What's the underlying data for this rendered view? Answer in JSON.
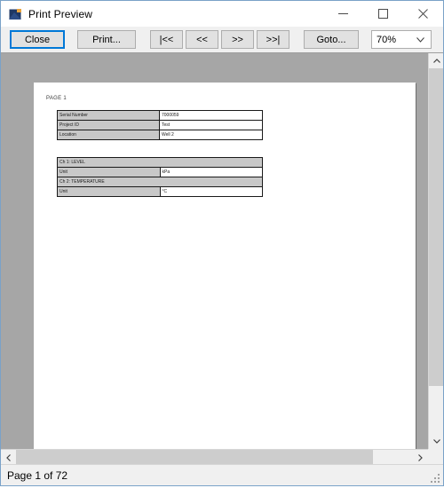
{
  "window": {
    "title": "Print Preview",
    "icon": "image-preview-icon",
    "controls": {
      "minimize": "minimize-icon",
      "maximize": "maximize-icon",
      "close": "close-icon"
    }
  },
  "toolbar": {
    "close_label": "Close",
    "print_label": "Print...",
    "first_page_label": "|<<",
    "prev_page_label": "<<",
    "next_page_label": ">>",
    "last_page_label": ">>|",
    "goto_label": "Goto...",
    "zoom_value": "70%",
    "zoom_arrow": "chevron-down-icon"
  },
  "preview": {
    "page_label": "PAGE 1",
    "info_table": {
      "rows": [
        {
          "label": "Serial Number",
          "value": "7000059"
        },
        {
          "label": "Project ID",
          "value": "Test"
        },
        {
          "label": "Location",
          "value": "Well 2"
        }
      ]
    },
    "channel_table": {
      "rows": [
        {
          "kind": "section",
          "label": "Ch 1: LEVEL",
          "value": ""
        },
        {
          "kind": "pair",
          "label": "Unit",
          "value": "kPa"
        },
        {
          "kind": "section",
          "label": "Ch 2: TEMPERATURE",
          "value": ""
        },
        {
          "kind": "pair",
          "label": "Unit",
          "value": "°C"
        }
      ]
    }
  },
  "scrollbars": {
    "vertical": {
      "up_arrow": "chevron-up-icon",
      "down_arrow": "chevron-down-icon"
    },
    "horizontal": {
      "left_arrow": "chevron-left-icon",
      "right_arrow": "chevron-right-icon"
    }
  },
  "statusbar": {
    "text": "Page 1 of 72",
    "grip": "resize-grip-icon"
  },
  "colors": {
    "accent": "#0078d7",
    "window_chrome": "#f0f0f0",
    "preview_background": "#a6a6a6",
    "page_background": "#ffffff",
    "table_header_fill": "#c8c8c8",
    "scroll_thumb": "#cdcdcd"
  }
}
